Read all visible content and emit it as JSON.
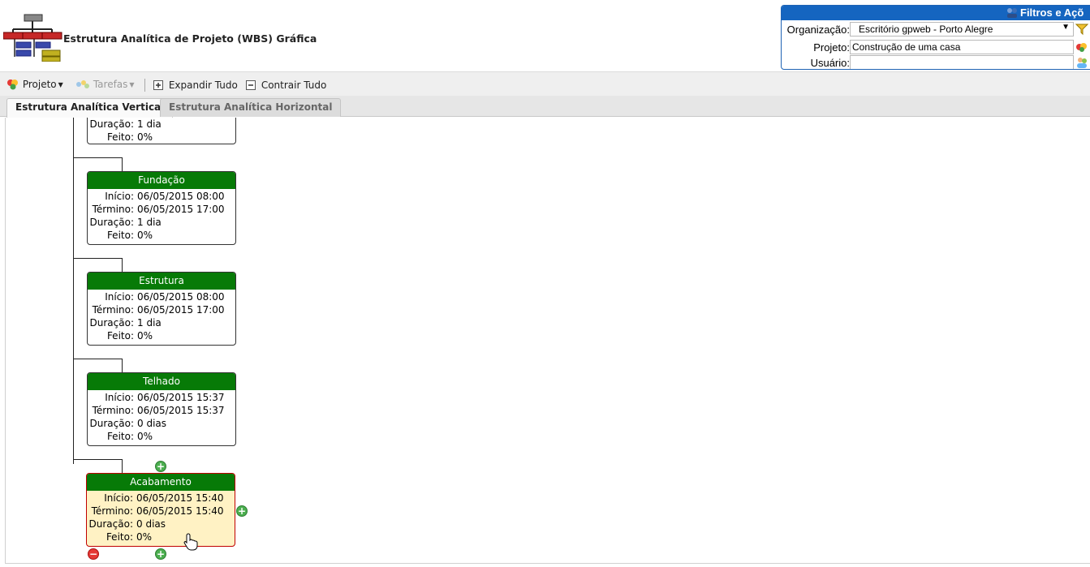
{
  "header": {
    "title": "Estrutura Analítica de Projeto (WBS) Gráfica"
  },
  "filters": {
    "title": "Filtros e Açõ",
    "organization_label": "Organização:",
    "organization_value": "Escritório gpweb - Porto Alegre",
    "project_label": "Projeto:",
    "project_value": "Construção de uma casa",
    "user_label": "Usuário:",
    "user_value": ""
  },
  "toolbar": {
    "project_label": "Projeto",
    "tasks_label": "Tarefas",
    "expand_label": "Expandir Tudo",
    "collapse_label": "Contrair Tudo"
  },
  "tabs": [
    {
      "label": "Estrutura Analítica Vertical",
      "active": true
    },
    {
      "label": "Estrutura Analítica Horizontal",
      "active": false
    }
  ],
  "labels": {
    "start": "Início:",
    "end": "Término:",
    "duration": "Duração:",
    "done": "Feito:"
  },
  "nodes": [
    {
      "title": "",
      "start": "",
      "end": "",
      "duration": "1 dia",
      "done": "0%"
    },
    {
      "title": "Fundação",
      "start": "06/05/2015 08:00",
      "end": "06/05/2015 17:00",
      "duration": "1 dia",
      "done": "0%"
    },
    {
      "title": "Estrutura",
      "start": "06/05/2015 08:00",
      "end": "06/05/2015 17:00",
      "duration": "1 dia",
      "done": "0%"
    },
    {
      "title": "Telhado",
      "start": "06/05/2015 15:37",
      "end": "06/05/2015 15:37",
      "duration": "0 dias",
      "done": "0%"
    },
    {
      "title": "Acabamento",
      "start": "06/05/2015 15:40",
      "end": "06/05/2015 15:40",
      "duration": "0 dias",
      "done": "0%"
    }
  ],
  "colors": {
    "node_header": "#077a07",
    "selected_border": "#c00000",
    "selected_bg": "#fff2c4",
    "filters_header": "#1565c0"
  }
}
